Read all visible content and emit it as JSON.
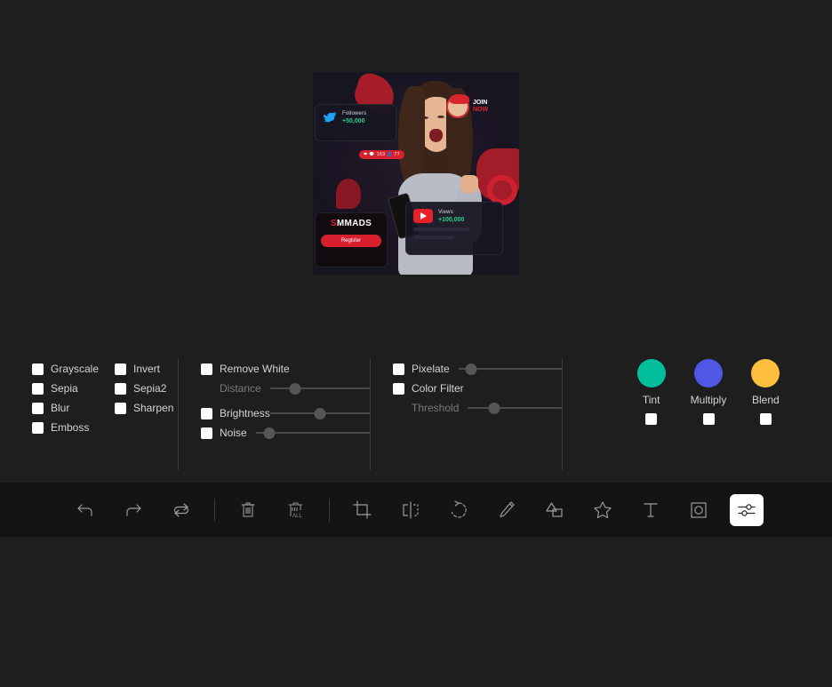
{
  "app": {
    "background": "#1e1e1e",
    "toolbar_background": "#141414"
  },
  "canvas": {
    "image": {
      "alt_name": "smm-ads-promo-image",
      "cards": {
        "followers": {
          "icon": "twitter-icon",
          "label": "Followers",
          "value": "+50,000"
        },
        "views": {
          "icon": "youtube-icon",
          "label": "Views",
          "value": "+100,000"
        },
        "brand": {
          "logo_s": "S",
          "logo_rest": "MMADS",
          "button": "Register"
        },
        "join": {
          "line1": "JOIN",
          "line2": "NOW"
        },
        "notification": "❤ 💬 163 👤 77"
      }
    }
  },
  "filters": {
    "checkboxes": [
      {
        "name": "grayscale",
        "label": "Grayscale",
        "checked": false
      },
      {
        "name": "invert",
        "label": "Invert",
        "checked": false
      },
      {
        "name": "sepia",
        "label": "Sepia",
        "checked": false
      },
      {
        "name": "sepia2",
        "label": "Sepia2",
        "checked": false
      },
      {
        "name": "blur",
        "label": "Blur",
        "checked": false
      },
      {
        "name": "sharpen",
        "label": "Sharpen",
        "checked": false
      },
      {
        "name": "emboss",
        "label": "Emboss",
        "checked": false
      }
    ],
    "column_two": {
      "remove_white": {
        "label": "Remove White",
        "checked": false
      },
      "distance": {
        "label": "Distance",
        "value": 25,
        "enabled": false
      },
      "brightness": {
        "label": "Brightness",
        "checked": false,
        "value": 50
      },
      "noise": {
        "label": "Noise",
        "checked": false,
        "value": 12
      }
    },
    "column_three": {
      "pixelate": {
        "label": "Pixelate",
        "checked": false,
        "value": 12
      },
      "color_filter": {
        "label": "Color Filter",
        "checked": false
      },
      "threshold": {
        "label": "Threshold",
        "value": 28,
        "enabled": false
      }
    },
    "colors": [
      {
        "name": "tint",
        "label": "Tint",
        "color": "#00bf9a",
        "checked": false
      },
      {
        "name": "multiply",
        "label": "Multiply",
        "color": "#5056e5",
        "checked": false
      },
      {
        "name": "blend",
        "label": "Blend",
        "color": "#ffbe3d",
        "checked": false
      }
    ]
  },
  "toolbar": {
    "items": [
      {
        "name": "undo-icon",
        "label": "Undo",
        "active": false
      },
      {
        "name": "redo-icon",
        "label": "Redo",
        "active": false
      },
      {
        "name": "reset-icon",
        "label": "Reset",
        "active": false
      },
      {
        "name": "delete-icon",
        "label": "Delete",
        "active": false
      },
      {
        "name": "delete-all-icon",
        "label": "Delete All",
        "active": false,
        "badge": "ALL"
      },
      {
        "name": "crop-icon",
        "label": "Crop",
        "active": false
      },
      {
        "name": "flip-icon",
        "label": "Flip",
        "active": false
      },
      {
        "name": "rotate-icon",
        "label": "Rotate",
        "active": false
      },
      {
        "name": "draw-icon",
        "label": "Draw",
        "active": false
      },
      {
        "name": "shape-icon",
        "label": "Shape",
        "active": false
      },
      {
        "name": "icon-icon",
        "label": "Icon",
        "active": false
      },
      {
        "name": "text-icon",
        "label": "Text",
        "active": false
      },
      {
        "name": "mask-icon",
        "label": "Mask",
        "active": false
      },
      {
        "name": "filter-icon",
        "label": "Filter",
        "active": true
      }
    ]
  }
}
